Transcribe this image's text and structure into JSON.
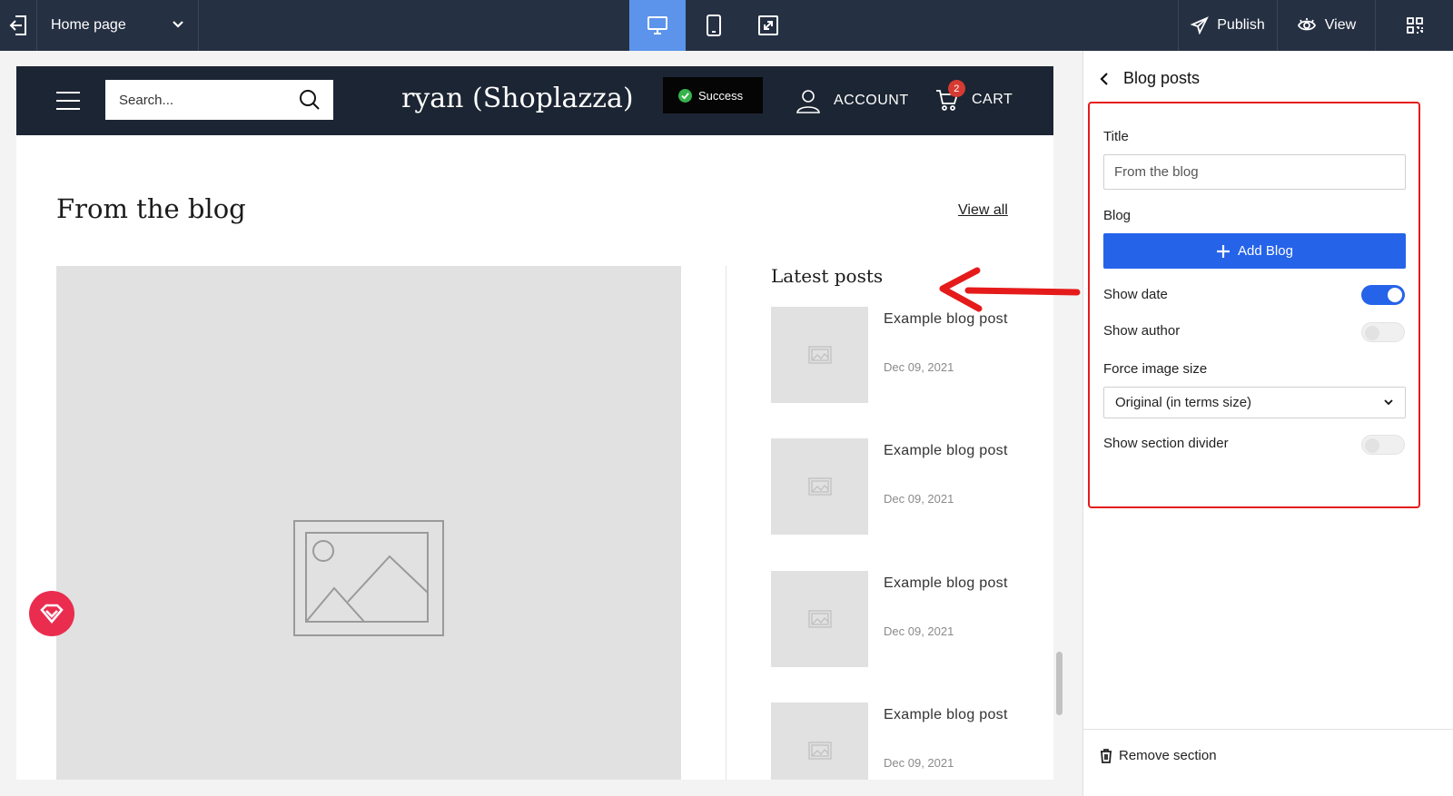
{
  "topbar": {
    "page_select": "Home page",
    "publish_label": "Publish",
    "view_label": "View"
  },
  "shop": {
    "search_placeholder": "Search...",
    "logo": "ryan (Shoplazza)",
    "toast": "Success",
    "account_label": "ACCOUNT",
    "cart_label": "CART",
    "cart_count": "2"
  },
  "section": {
    "title": "From the blog",
    "view_all": "View all",
    "latest_heading": "Latest posts",
    "posts": [
      {
        "title": "Example blog post",
        "date": "Dec 09, 2021"
      },
      {
        "title": "Example blog post",
        "date": "Dec 09, 2021"
      },
      {
        "title": "Example blog post",
        "date": "Dec 09, 2021"
      },
      {
        "title": "Example blog post",
        "date": "Dec 09, 2021"
      }
    ]
  },
  "panel": {
    "heading": "Blog posts",
    "title_label": "Title",
    "title_value": "From the blog",
    "blog_label": "Blog",
    "add_blog": "Add Blog",
    "show_date_label": "Show date",
    "show_date": true,
    "show_author_label": "Show author",
    "show_author": false,
    "force_image_label": "Force image size",
    "force_image_value": "Original (in terms size)",
    "divider_label": "Show section divider",
    "show_divider": false,
    "remove_label": "Remove section"
  },
  "colors": {
    "topbar_bg": "#263043",
    "device_active": "#5b94ea",
    "shop_header": "#1c2533",
    "primary_button": "#2563e9",
    "annotation_red": "#e51b1b",
    "success_green": "#35b34a",
    "badge_red": "#d63b32"
  }
}
